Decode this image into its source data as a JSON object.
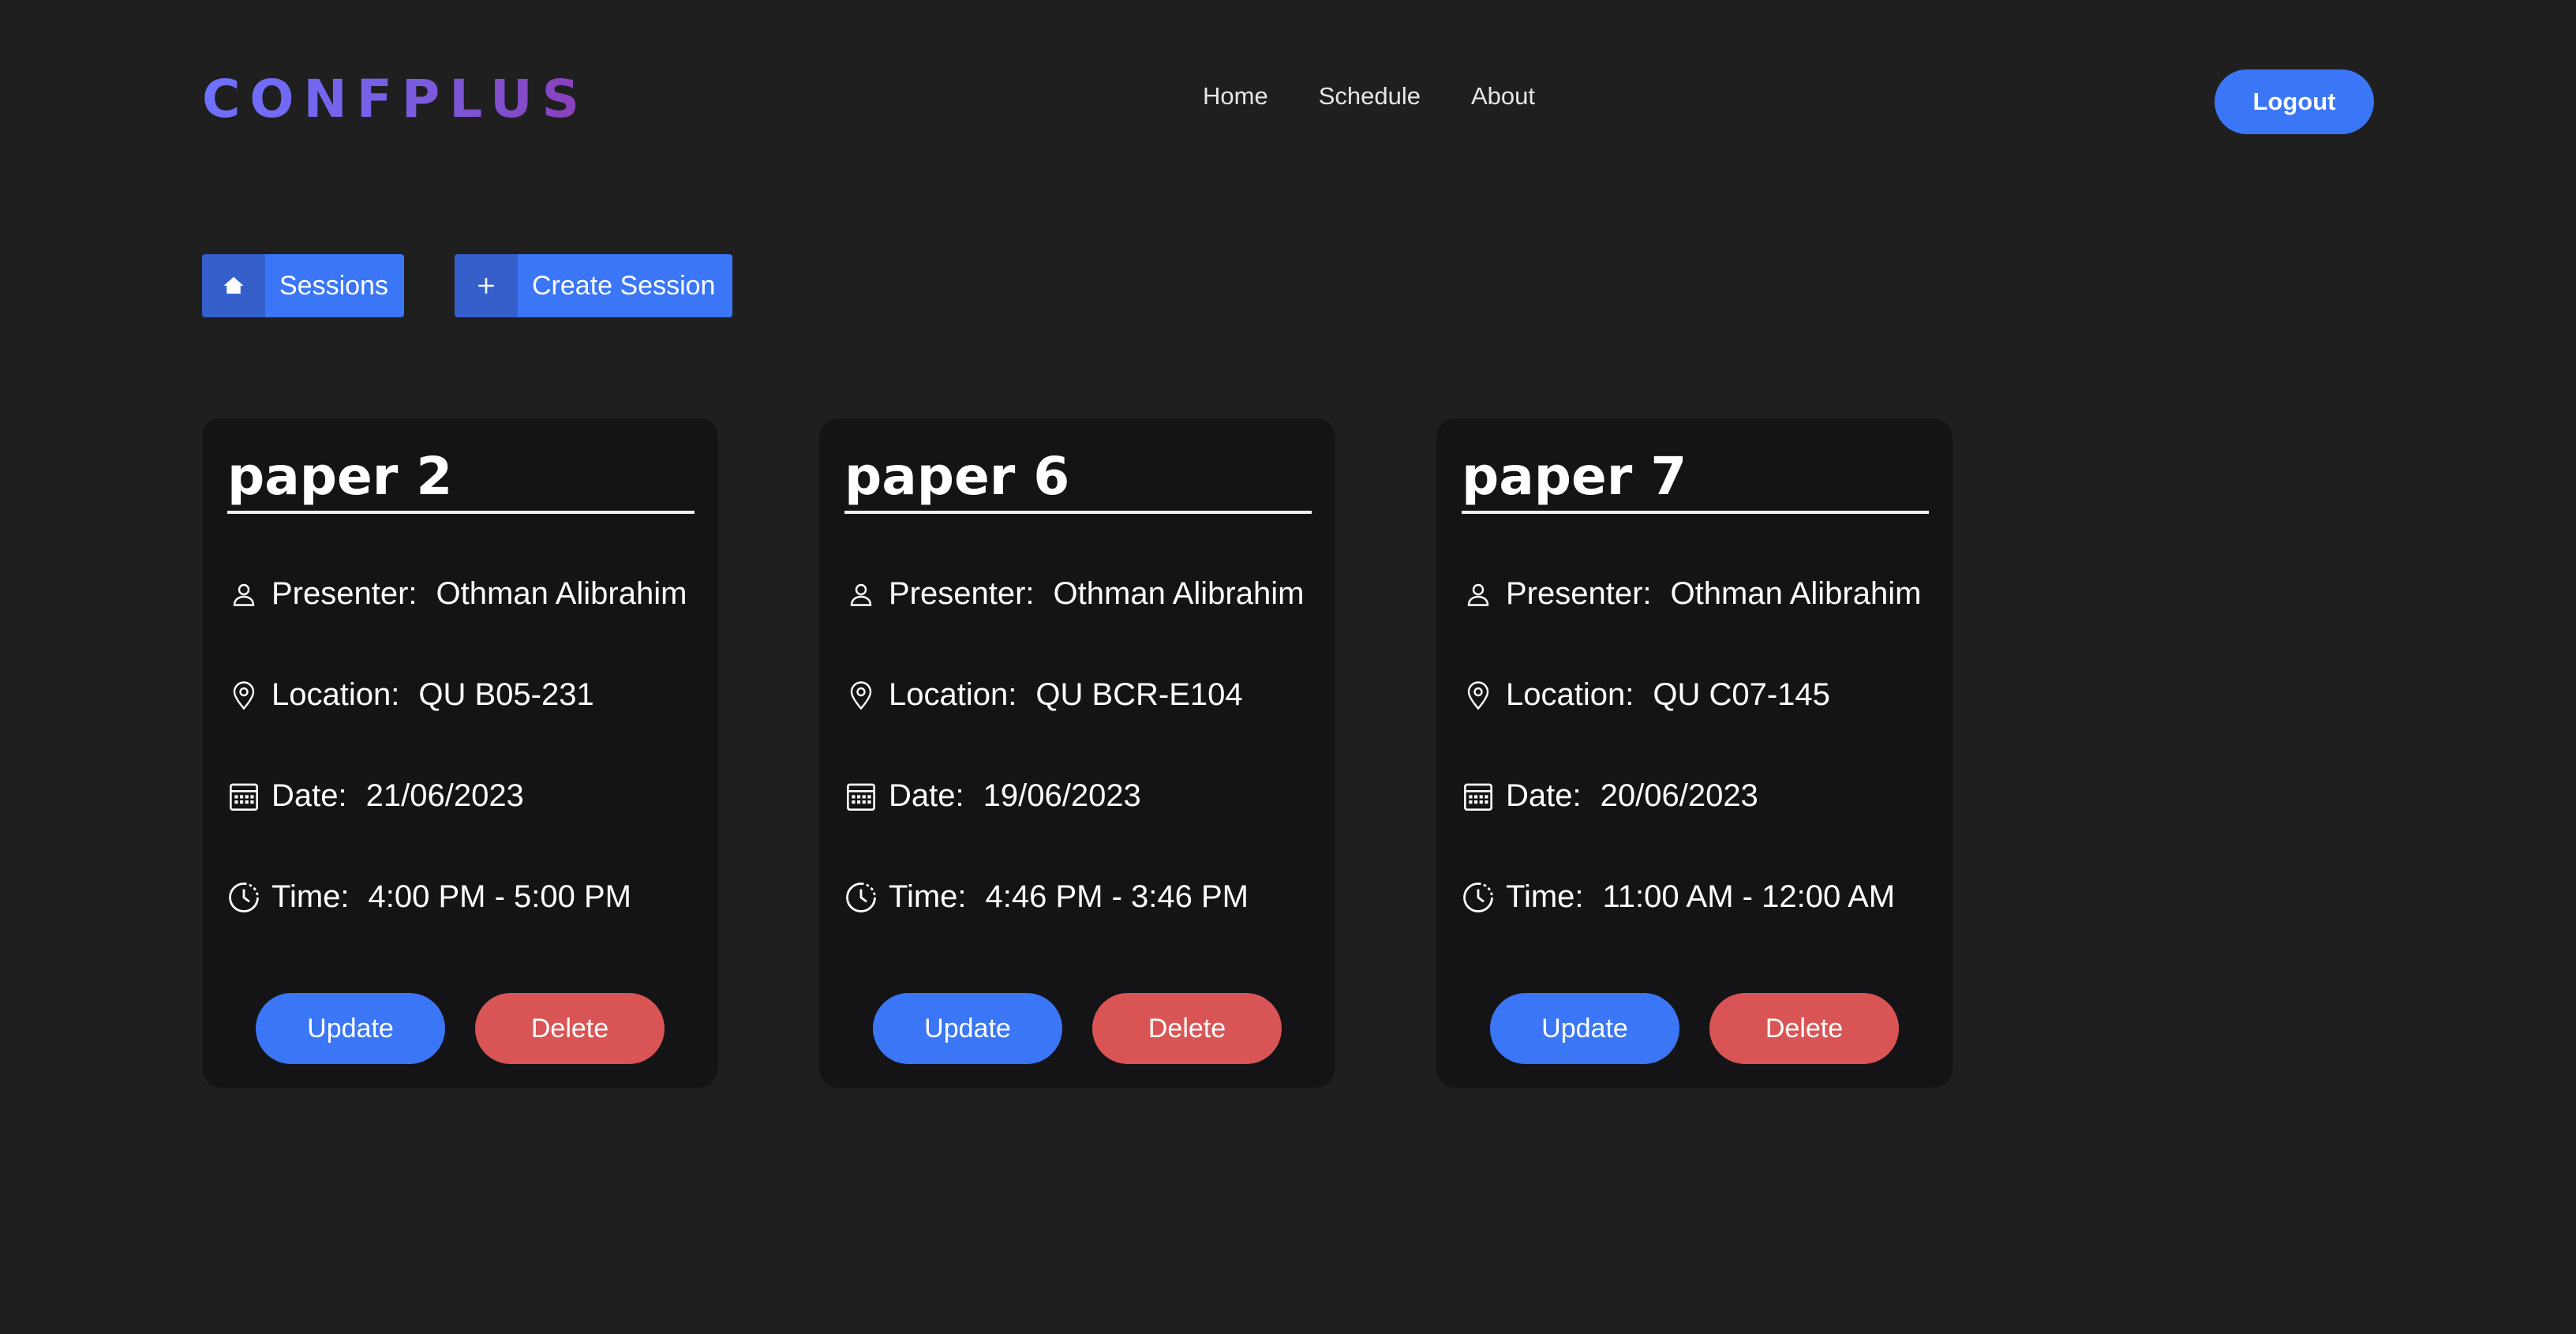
{
  "header": {
    "logo_text": "CONFPLUS",
    "nav": [
      "Home",
      "Schedule",
      "About"
    ],
    "logout_label": "Logout"
  },
  "actions": {
    "sessions_label": "Sessions",
    "create_label": "Create Session"
  },
  "field_labels": {
    "presenter": "Presenter:",
    "location": "Location:",
    "date": "Date:",
    "time": "Time:"
  },
  "card_buttons": {
    "update": "Update",
    "delete": "Delete"
  },
  "sessions": [
    {
      "title": "paper 2",
      "presenter": "Othman Alibrahim",
      "location": "QU B05-231",
      "date": "21/06/2023",
      "time": "4:00 PM - 5:00 PM"
    },
    {
      "title": "paper 6",
      "presenter": "Othman Alibrahim",
      "location": "QU BCR-E104",
      "date": "19/06/2023",
      "time": "4:46 PM - 3:46 PM"
    },
    {
      "title": "paper 7",
      "presenter": "Othman Alibrahim",
      "location": "QU C07-145",
      "date": "20/06/2023",
      "time": "11:00 AM - 12:00 AM"
    }
  ],
  "colors": {
    "background": "#1f1f1f",
    "card": "#141416",
    "primary": "#3a76f6",
    "danger": "#d95555"
  },
  "icons": {
    "sessions": "home-icon",
    "create": "plus-icon",
    "presenter": "user-icon",
    "location": "map-pin-icon",
    "date": "calendar-icon",
    "time": "clock-icon"
  }
}
